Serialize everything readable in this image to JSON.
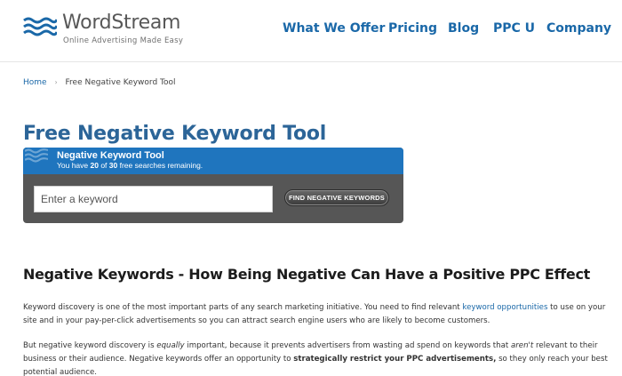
{
  "brand": {
    "name": "WordStream",
    "tagline": "Online Advertising Made Easy",
    "color": "#1a68a8"
  },
  "nav": {
    "items": [
      {
        "label": "What We Offer"
      },
      {
        "label": "Pricing"
      },
      {
        "label": "Blog"
      },
      {
        "label": "PPC U"
      },
      {
        "label": "Company"
      }
    ]
  },
  "breadcrumb": {
    "home": "Home",
    "separator": "›",
    "current": "Free Negative Keyword Tool"
  },
  "page": {
    "title": "Free Negative Keyword Tool"
  },
  "tool": {
    "title": "Negative Keyword Tool",
    "status_prefix": "You have ",
    "searches_used": "20",
    "status_mid": " of ",
    "searches_total": "30",
    "status_suffix": " free searches remaining.",
    "input_placeholder": "Enter a keyword",
    "button_label": "FIND NEGATIVE KEYWORDS",
    "header_color": "#1f75be",
    "panel_color": "#565656"
  },
  "article": {
    "heading": "Negative Keywords - How Being Negative Can Have a Positive PPC Effect",
    "para1_a": "Keyword discovery is one of the most important parts of any search marketing initiative. You need to find relevant ",
    "para1_link": "keyword opportunities",
    "para1_b": " to use on your site and in your pay-per-click advertisements so you can attract search engine users who are likely to become customers.",
    "para2_a": "But negative keyword discovery is ",
    "para2_em1": "equally",
    "para2_b": " important, because it prevents advertisers from wasting ad spend on keywords that ",
    "para2_em2": "aren't",
    "para2_c": " relevant to their business or their audience. Negative keywords offer an opportunity to ",
    "para2_strong": "strategically restrict your PPC advertisements,",
    "para2_d": " so they only reach your best potential audience."
  }
}
